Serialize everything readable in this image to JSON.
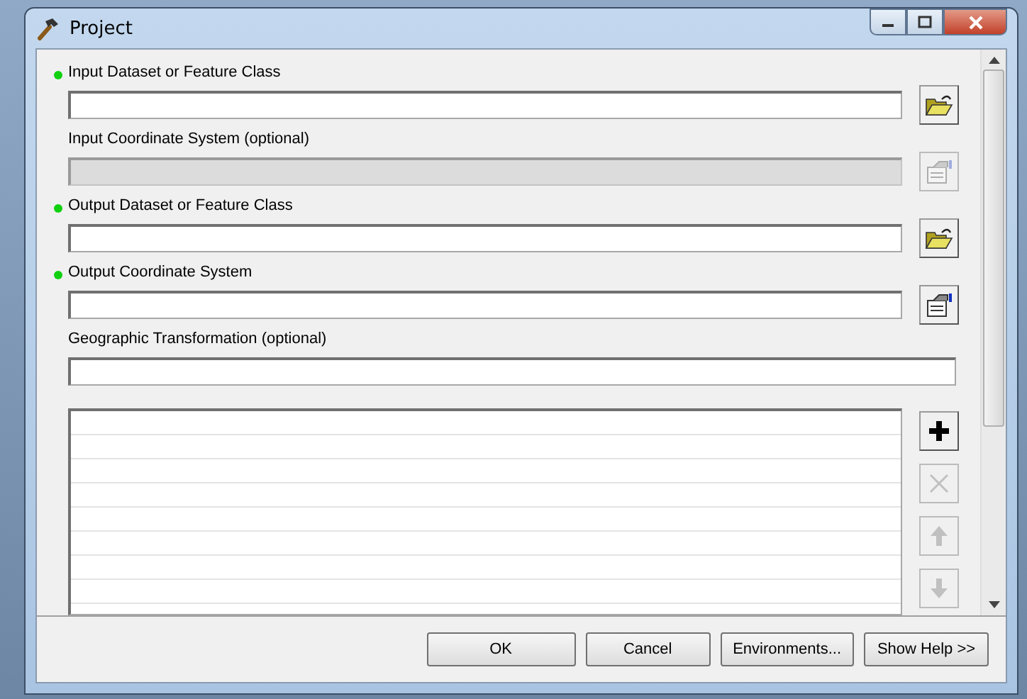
{
  "window": {
    "title": "Project"
  },
  "parameters": [
    {
      "label": "Input Dataset or Feature Class",
      "required": true,
      "disabled": false,
      "kind": "dataset"
    },
    {
      "label": "Input Coordinate System (optional)",
      "required": false,
      "disabled": true,
      "kind": "coordsys"
    },
    {
      "label": "Output Dataset or Feature Class",
      "required": true,
      "disabled": false,
      "kind": "dataset"
    },
    {
      "label": "Output Coordinate System",
      "required": true,
      "disabled": false,
      "kind": "coordsys"
    },
    {
      "label": "Geographic Transformation (optional)",
      "required": false,
      "disabled": false,
      "kind": "text"
    }
  ],
  "list_tools": [
    {
      "kind": "add",
      "disabled": false
    },
    {
      "kind": "remove",
      "disabled": true
    },
    {
      "kind": "up",
      "disabled": true
    },
    {
      "kind": "down",
      "disabled": true
    }
  ],
  "buttons": [
    "OK",
    "Cancel",
    "Environments...",
    "Show Help >>"
  ]
}
